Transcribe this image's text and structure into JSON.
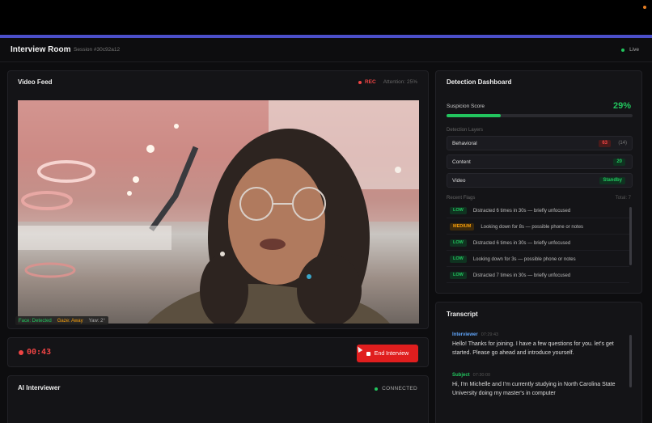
{
  "header": {
    "title": "Interview Room",
    "session": "Session #30c92a12",
    "live_label": "Live"
  },
  "video": {
    "title": "Video Feed",
    "rec_label": "REC",
    "attention": "Attention: 25%",
    "face_status": {
      "face": "Face: Detected",
      "gaze": "Gaze: Away",
      "yaw": "Yaw: 2°"
    }
  },
  "timer": {
    "value": "00:43",
    "end_label": "End Interview"
  },
  "ai": {
    "title": "AI Interviewer",
    "status": "CONNECTED"
  },
  "dashboard": {
    "title": "Detection Dashboard",
    "suspicion_label": "Suspicion Score",
    "suspicion_value": "29%",
    "suspicion_fraction": 0.29,
    "layers_label": "Detection Layers",
    "layers": [
      {
        "name": "Behavioral",
        "badge": "63",
        "extra": "(14)"
      },
      {
        "name": "Content",
        "badge": "20",
        "extra": ""
      },
      {
        "name": "Video",
        "badge": "Standby",
        "extra": ""
      }
    ],
    "flags_label": "Recent Flags",
    "flags_total": "Total: 7",
    "flags": [
      {
        "severity": "LOW",
        "text": "Distracted 6 times in 30s — briefly unfocused"
      },
      {
        "severity": "MEDIUM",
        "text": "Looking down for 8s — possible phone or notes"
      },
      {
        "severity": "LOW",
        "text": "Distracted 6 times in 30s — briefly unfocused"
      },
      {
        "severity": "LOW",
        "text": "Looking down for 3s — possible phone or notes"
      },
      {
        "severity": "LOW",
        "text": "Distracted 7 times in 30s — briefly unfocused"
      }
    ]
  },
  "transcript": {
    "title": "Transcript",
    "messages": [
      {
        "speaker": "Interviewer",
        "time": "07:29:43",
        "text": "Hello! Thanks for joining. I have a few questions for you. let's get started. Please go ahead and introduce yourself."
      },
      {
        "speaker": "Subject",
        "time": "07:30:00",
        "text": "Hi, I'm Michelle and I'm currently studying in North Carolina State University doing my master's in computer"
      }
    ]
  },
  "colors": {
    "accent": "#4b4fc9",
    "danger": "#ef4444",
    "success": "#22c55e",
    "warning": "#f59e0b",
    "interviewer": "#60a5fa"
  }
}
